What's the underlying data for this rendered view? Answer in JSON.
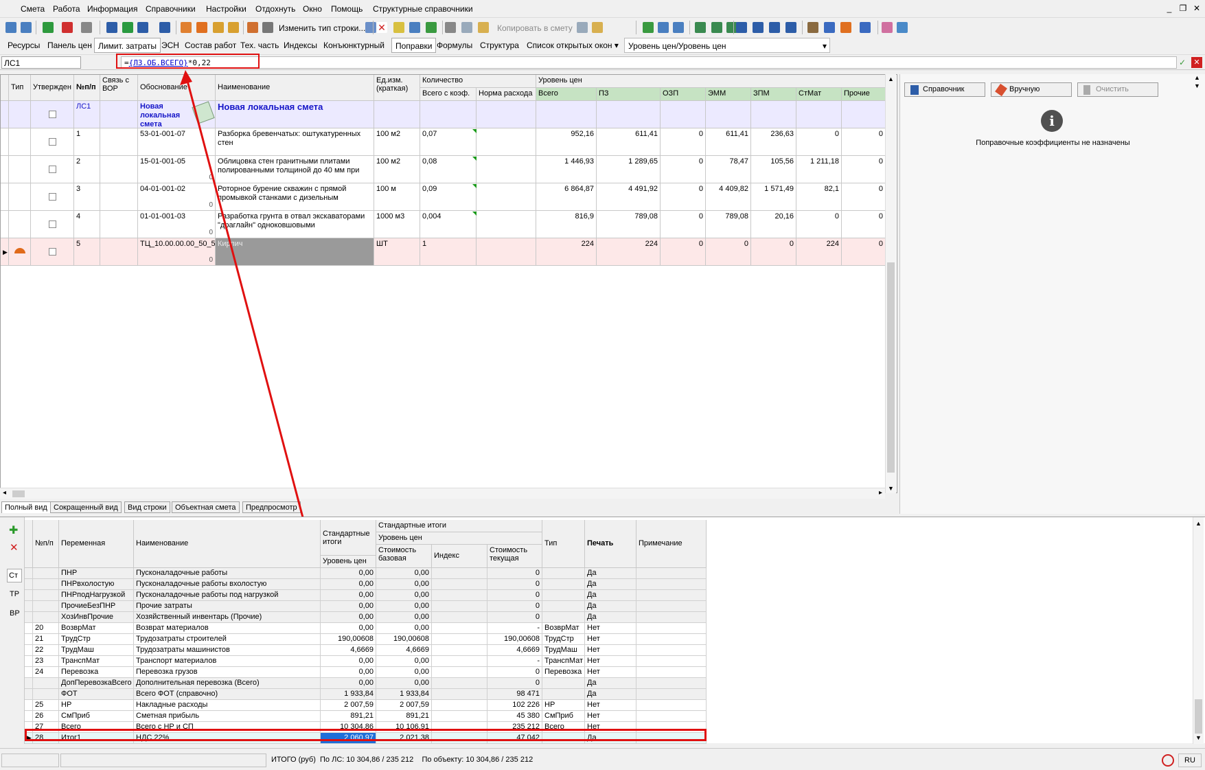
{
  "menu": [
    "Смета",
    "Работа",
    "Информация",
    "Справочники",
    "Настройки",
    "Отдохнуть",
    "Окно",
    "Помощь",
    "Структурные справочники"
  ],
  "toolbar1": {
    "change_row_type": "Изменить тип строки...",
    "copy_to_estimate": "Копировать в смету"
  },
  "tabs": [
    "Ресурсы",
    "Панель цен",
    "Лимит. затраты",
    "ЭСН",
    "Состав работ",
    "Тех. часть",
    "Индексы",
    "Конъюнктурный",
    "Поправки",
    "Формулы",
    "Структура",
    "Список открытых окон"
  ],
  "price_level_select": "Уровень цен/Уровень цен",
  "formula_bar": {
    "cell_ref": "ЛС1",
    "formula_eq": "=",
    "formula_ref": "{ЛЗ.ОБ.ВСЕГО}",
    "formula_rest": "*0,22"
  },
  "upper_grid": {
    "headers": {
      "type": "Тип",
      "approved": "Утвержден",
      "num": "№п/п",
      "link": "Связь с ВОР",
      "basis": "Обоснование",
      "name": "Наименование",
      "unit": "Ед.изм. (краткая)",
      "qty": "Количество",
      "qty_total": "Всего с коэф.",
      "qty_norm": "Норма расхода",
      "price_level": "Уровень цен",
      "total": "Всего",
      "pz": "ПЗ",
      "ozp": "ОЗП",
      "emm": "ЭММ",
      "zpm": "ЗПМ",
      "stmat": "СтМат",
      "other": "Прочие"
    },
    "header_row": {
      "num": "ЛС1",
      "basis": "Новая локальная смета",
      "name": "Новая локальная смета"
    },
    "rows": [
      {
        "num": "1",
        "basis": "53-01-001-07",
        "name": "Разборка бревенчатых: оштукатуренных стен",
        "unit": "100 м2",
        "qty": "0,07",
        "total": "952,16",
        "pz": "611,41",
        "ozp": "0",
        "emm": "611,41",
        "zpm": "236,63",
        "stmat": "0",
        "other": "0"
      },
      {
        "num": "2",
        "basis": "15-01-001-05",
        "name": "Облицовка стен гранитными плитами полированными толщиной до 40 мм при",
        "unit": "100 м2",
        "qty": "0,08",
        "total": "1 446,93",
        "pz": "1 289,65",
        "ozp": "0",
        "emm": "78,47",
        "zpm": "105,56",
        "stmat": "1 211,18",
        "other": "0"
      },
      {
        "num": "3",
        "basis": "04-01-001-02",
        "name": "Роторное бурение скважин с прямой промывкой станками с дизельным",
        "unit": "100 м",
        "qty": "0,09",
        "total": "6 864,87",
        "pz": "4 491,92",
        "ozp": "0",
        "emm": "4 409,82",
        "zpm": "1 571,49",
        "stmat": "82,1",
        "other": "0"
      },
      {
        "num": "4",
        "basis": "01-01-001-03",
        "name": "Разработка грунта в отвал экскаваторами \"драглайн\" одноковшовыми",
        "unit": "1000 м3",
        "qty": "0,004",
        "total": "816,9",
        "pz": "789,08",
        "ozp": "0",
        "emm": "789,08",
        "zpm": "20,16",
        "stmat": "0",
        "other": "0"
      },
      {
        "num": "5",
        "basis": "ТЦ_10.00.00.00_50_5",
        "name": "Кирпич",
        "unit": "ШТ",
        "qty": "1",
        "total": "224",
        "pz": "224",
        "ozp": "0",
        "emm": "0",
        "zpm": "0",
        "stmat": "224",
        "other": "0"
      }
    ]
  },
  "bottom_tabs": [
    "Полный вид",
    "Сокращенный вид",
    "Вид строки",
    "Объектная смета",
    "Предпросмотр"
  ],
  "right_panel": {
    "btn_reference": "Справочник",
    "btn_manual": "Вручную",
    "btn_clear": "Очистить",
    "message": "Поправочные коэффициенты не назначены"
  },
  "lower_side": [
    "Ст",
    "ТР",
    "ВР"
  ],
  "lower_grid": {
    "headers": {
      "num": "№п/п",
      "var": "Переменная",
      "name": "Наименование",
      "std_totals": "Стандартные итоги",
      "price_level": "Уровень цен",
      "std_totals2": "Стандартные итоги",
      "price_level2": "Уровень цен",
      "base_cost": "Стоимость базовая",
      "index": "Индекс",
      "cur_cost": "Стоимость текущая",
      "type": "Тип",
      "print": "Печать",
      "note": "Примечание"
    },
    "rows": [
      {
        "num": "",
        "var": "ПНР",
        "name": "Пусконаладочные работы",
        "lvl": "0,00",
        "base": "0,00",
        "idx": "",
        "cur": "0",
        "type": "",
        "print": "Да"
      },
      {
        "num": "",
        "var": "ПНРвхолостую",
        "name": "Пусконаладочные работы вхолостую",
        "lvl": "0,00",
        "base": "0,00",
        "idx": "",
        "cur": "0",
        "type": "",
        "print": "Да"
      },
      {
        "num": "",
        "var": "ПНРподНагрузкой",
        "name": "Пусконаладочные работы под нагрузкой",
        "lvl": "0,00",
        "base": "0,00",
        "idx": "",
        "cur": "0",
        "type": "",
        "print": "Да"
      },
      {
        "num": "",
        "var": "ПрочиеБезПНР",
        "name": "Прочие затраты",
        "lvl": "0,00",
        "base": "0,00",
        "idx": "",
        "cur": "0",
        "type": "",
        "print": "Да"
      },
      {
        "num": "",
        "var": "ХозИнвПрочие",
        "name": "Хозяйственный инвентарь (Прочие)",
        "lvl": "0,00",
        "base": "0,00",
        "idx": "",
        "cur": "0",
        "type": "",
        "print": "Да"
      },
      {
        "num": "20",
        "var": "ВозврМат",
        "name": "Возврат материалов",
        "lvl": "0,00",
        "base": "0,00",
        "idx": "",
        "cur": "-",
        "type": "ВозврМат",
        "print": "Нет"
      },
      {
        "num": "21",
        "var": "ТрудСтр",
        "name": "Трудозатраты строителей",
        "lvl": "190,00608",
        "base": "190,00608",
        "idx": "",
        "cur": "190,00608",
        "type": "ТрудСтр",
        "print": "Нет"
      },
      {
        "num": "22",
        "var": "ТрудМаш",
        "name": "Трудозатраты машинистов",
        "lvl": "4,6669",
        "base": "4,6669",
        "idx": "",
        "cur": "4,6669",
        "type": "ТрудМаш",
        "print": "Нет"
      },
      {
        "num": "23",
        "var": "ТранспМат",
        "name": "Транспорт материалов",
        "lvl": "0,00",
        "base": "0,00",
        "idx": "",
        "cur": "-",
        "type": "ТранспМат",
        "print": "Нет"
      },
      {
        "num": "24",
        "var": "Перевозка",
        "name": "Перевозка грузов",
        "lvl": "0,00",
        "base": "0,00",
        "idx": "",
        "cur": "0",
        "type": "Перевозка",
        "print": "Нет"
      },
      {
        "num": "",
        "var": "ДопПеревозкаВсего",
        "name": "Дополнительная перевозка (Всего)",
        "lvl": "0,00",
        "base": "0,00",
        "idx": "",
        "cur": "0",
        "type": "",
        "print": "Да"
      },
      {
        "num": "",
        "var": "ФОТ",
        "name": "Всего ФОТ (справочно)",
        "lvl": "1 933,84",
        "base": "1 933,84",
        "idx": "",
        "cur": "98 471",
        "type": "",
        "print": "Да"
      },
      {
        "num": "25",
        "var": "НР",
        "name": "Накладные расходы",
        "lvl": "2 007,59",
        "base": "2 007,59",
        "idx": "",
        "cur": "102 226",
        "type": "НР",
        "print": "Нет"
      },
      {
        "num": "26",
        "var": "СмПриб",
        "name": "Сметная прибыль",
        "lvl": "891,21",
        "base": "891,21",
        "idx": "",
        "cur": "45 380",
        "type": "СмПриб",
        "print": "Нет"
      },
      {
        "num": "27",
        "var": "Всего",
        "name": "Всего с НР и СП",
        "lvl": "10 304,86",
        "base": "10 106,91",
        "idx": "",
        "cur": "235 212",
        "type": "Всего",
        "print": "Нет"
      },
      {
        "num": "28",
        "var": "Итог1",
        "name": "НДС 22%",
        "lvl": "2 060,97",
        "base": "2 021,38",
        "idx": "",
        "cur": "47 042",
        "type": "",
        "print": "Да"
      }
    ]
  },
  "status": {
    "total_label": "ИТОГО (руб)",
    "by_ls": "По ЛС: 10 304,86 / 235 212",
    "by_object": "По объекту: 10 304,86 / 235 212",
    "lang": "RU"
  },
  "colors": {
    "accent_red": "#e01010",
    "header_green": "#c6e3c3",
    "row_lavender": "#eceaff",
    "row_pink": "#fde8e8",
    "selected_blue": "#1e6fd9",
    "name_blue": "#1515c8"
  }
}
